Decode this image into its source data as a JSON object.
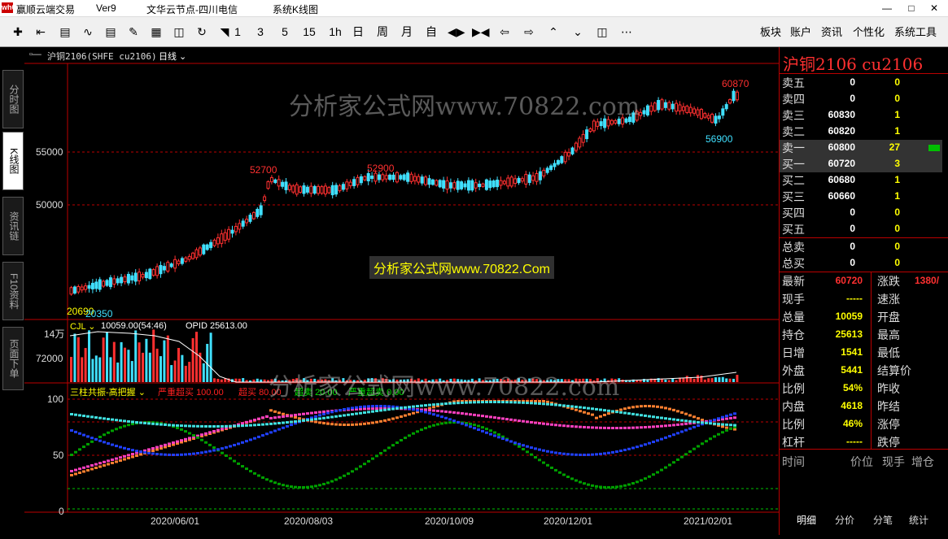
{
  "window": {
    "app_name": "赢顺云端交易",
    "version": "Ver9",
    "server": "文华云节点-四川电信",
    "chart_name": "系统K线图",
    "logo_text": "wh6"
  },
  "toolbar": {
    "icons": [
      "grid-icon",
      "back-icon",
      "table-icon",
      "line-chart-icon",
      "kline-icon",
      "draw-icon",
      "bar-icon",
      "save-icon",
      "refresh-icon",
      "bar-scale-icon"
    ],
    "periods": [
      "1",
      "3",
      "5",
      "15",
      "1h",
      "日",
      "周",
      "月",
      "自"
    ],
    "nav_icons": [
      "fit-icon",
      "zoom-out-icon",
      "arrow-left-icon",
      "arrow-right-icon",
      "arrow-up-icon",
      "arrow-down-icon",
      "layout-icon",
      "more-icon"
    ],
    "right_menu": [
      "板块",
      "账户",
      "资讯",
      "个性化",
      "系统工具"
    ]
  },
  "sidebar": {
    "tabs": [
      "分时图",
      "K线图",
      "资讯链",
      "F10资料",
      "页面下单"
    ],
    "active": 1
  },
  "chart_header": {
    "instrument": "沪铜2106(SHFE cu2106)",
    "period": "日线"
  },
  "chart_data": {
    "type": "candlestick",
    "price_ticks": [
      55000,
      50000
    ],
    "annotations": [
      {
        "label": "52700",
        "value": 52700
      },
      {
        "label": "52900",
        "value": 52900
      },
      {
        "label": "60870",
        "value": 60870
      },
      {
        "label": "56900",
        "value": 56900
      },
      {
        "label": "20690",
        "value": 20690
      },
      {
        "label": "20350",
        "value": 20350
      }
    ],
    "x_dates": [
      "2020/06/01",
      "2020/08/03",
      "2020/10/09",
      "2020/12/01",
      "2021/02/01"
    ],
    "volume_label": "CJL",
    "volume_info": "10059.00(54:46)",
    "opid_label": "OPID 25613.00",
    "volume_ticks": [
      "14万",
      "72000"
    ],
    "osc_name": "三柱共振-高把握",
    "osc_legend": [
      {
        "label": "严重超买",
        "value": "100.00",
        "color": "#ff2020"
      },
      {
        "label": "超买",
        "value": "80.00",
        "color": "#ff2020"
      },
      {
        "label": "超卖",
        "value": "20.00",
        "color": "#00e000"
      },
      {
        "label": "严重超卖",
        "value": "0.00",
        "color": "#00e000"
      }
    ],
    "osc_ticks": [
      "100",
      "50",
      "0"
    ]
  },
  "watermark": {
    "text_top": "分析家公式网www.70822.com",
    "text_mid": "分析家公式网www.70822.Com",
    "text_low": "分析家公式网www.70822.com"
  },
  "quote_panel": {
    "title": "沪铜2106 cu2106",
    "order_book": [
      {
        "label": "卖五",
        "price": "0",
        "vol": "0"
      },
      {
        "label": "卖四",
        "price": "0",
        "vol": "0"
      },
      {
        "label": "卖三",
        "price": "60830",
        "vol": "1"
      },
      {
        "label": "卖二",
        "price": "60820",
        "vol": "1"
      },
      {
        "label": "卖一",
        "price": "60800",
        "vol": "27"
      },
      {
        "label": "买一",
        "price": "60720",
        "vol": "3"
      },
      {
        "label": "买二",
        "price": "60680",
        "vol": "1"
      },
      {
        "label": "买三",
        "price": "60660",
        "vol": "1"
      },
      {
        "label": "买四",
        "price": "0",
        "vol": "0"
      },
      {
        "label": "买五",
        "price": "0",
        "vol": "0"
      }
    ],
    "totals": [
      {
        "label": "总卖",
        "price": "0",
        "vol": "0"
      },
      {
        "label": "总买",
        "price": "0",
        "vol": "0"
      }
    ],
    "stats_left": [
      {
        "label": "最新",
        "value": "60720",
        "color": "#ff3030"
      },
      {
        "label": "现手",
        "value": "-----",
        "color": "#ffff00"
      },
      {
        "label": "总量",
        "value": "10059",
        "color": "#ffff00"
      },
      {
        "label": "持仓",
        "value": "25613",
        "color": "#ffff00"
      },
      {
        "label": "日增",
        "value": "1541",
        "color": "#ffff00"
      },
      {
        "label": "外盘",
        "value": "5441",
        "color": "#ffff00"
      },
      {
        "label": "比例",
        "value": "54%",
        "color": "#ffff00"
      },
      {
        "label": "内盘",
        "value": "4618",
        "color": "#ffff00"
      },
      {
        "label": "比例",
        "value": "46%",
        "color": "#ffff00"
      },
      {
        "label": "杠杆",
        "value": "-----",
        "color": "#ffff00"
      }
    ],
    "stats_right": [
      {
        "label": "涨跌",
        "value": "1380/"
      },
      {
        "label": "速涨",
        "value": ""
      },
      {
        "label": "开盘",
        "value": ""
      },
      {
        "label": "最高",
        "value": ""
      },
      {
        "label": "最低",
        "value": ""
      },
      {
        "label": "结算价",
        "value": ""
      },
      {
        "label": "昨收",
        "value": ""
      },
      {
        "label": "昨结",
        "value": ""
      },
      {
        "label": "涨停",
        "value": ""
      },
      {
        "label": "跌停",
        "value": ""
      }
    ],
    "trade_headers": [
      "时间",
      "价位",
      "现手",
      "增仓"
    ],
    "bottom_tabs": [
      "明细",
      "分价",
      "分笔",
      "统计"
    ]
  }
}
